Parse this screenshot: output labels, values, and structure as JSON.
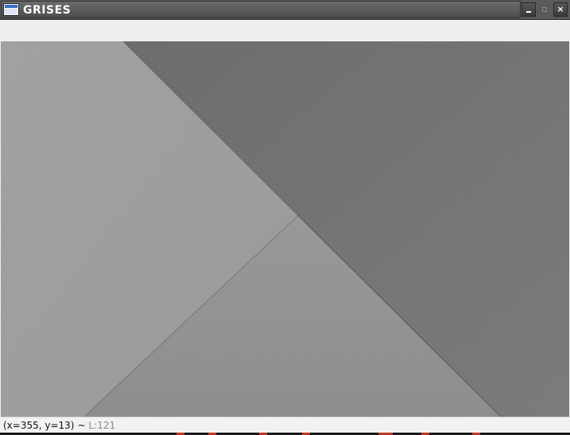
{
  "window": {
    "title": "GRISES",
    "icon": "app-window-icon"
  },
  "controls": {
    "minimize_icon": "minimize-icon",
    "maximize_icon": "maximize-icon",
    "close_label": "×",
    "close_icon": "close-icon"
  },
  "image": {
    "description_icon": "grayscale-image",
    "tones": {
      "left_panel": "#a5a5a5",
      "upper_right_panel": "#7a7a7a",
      "bottom_panel": "#959595",
      "fold_line": "#5e5e5e"
    }
  },
  "status": {
    "coords": "(x=355, y=13)",
    "separator": "~",
    "level": "L:121"
  }
}
